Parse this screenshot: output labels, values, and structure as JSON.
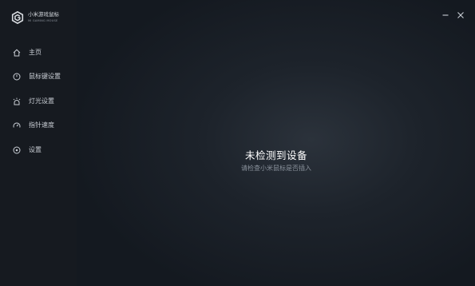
{
  "brand": {
    "name": "小米游戏鼠标",
    "subtitle": "MI GAMING MOUSE"
  },
  "nav": {
    "items": [
      {
        "label": "主页",
        "icon": "home-icon"
      },
      {
        "label": "鼠标键设置",
        "icon": "mouse-button-icon"
      },
      {
        "label": "灯光设置",
        "icon": "light-icon"
      },
      {
        "label": "指针速度",
        "icon": "speed-gauge-icon"
      },
      {
        "label": "设置",
        "icon": "settings-icon"
      }
    ]
  },
  "window_controls": {
    "minimize_icon": "minimize-icon",
    "close_icon": "close-icon"
  },
  "status": {
    "title": "未检测到设备",
    "hint": "请检查小米鼠标是否插入"
  },
  "colors": {
    "sidebar_bg": "#161a20",
    "main_bg": "#1d232b",
    "text_primary": "#ffffff",
    "text_secondary": "#8a929c"
  }
}
